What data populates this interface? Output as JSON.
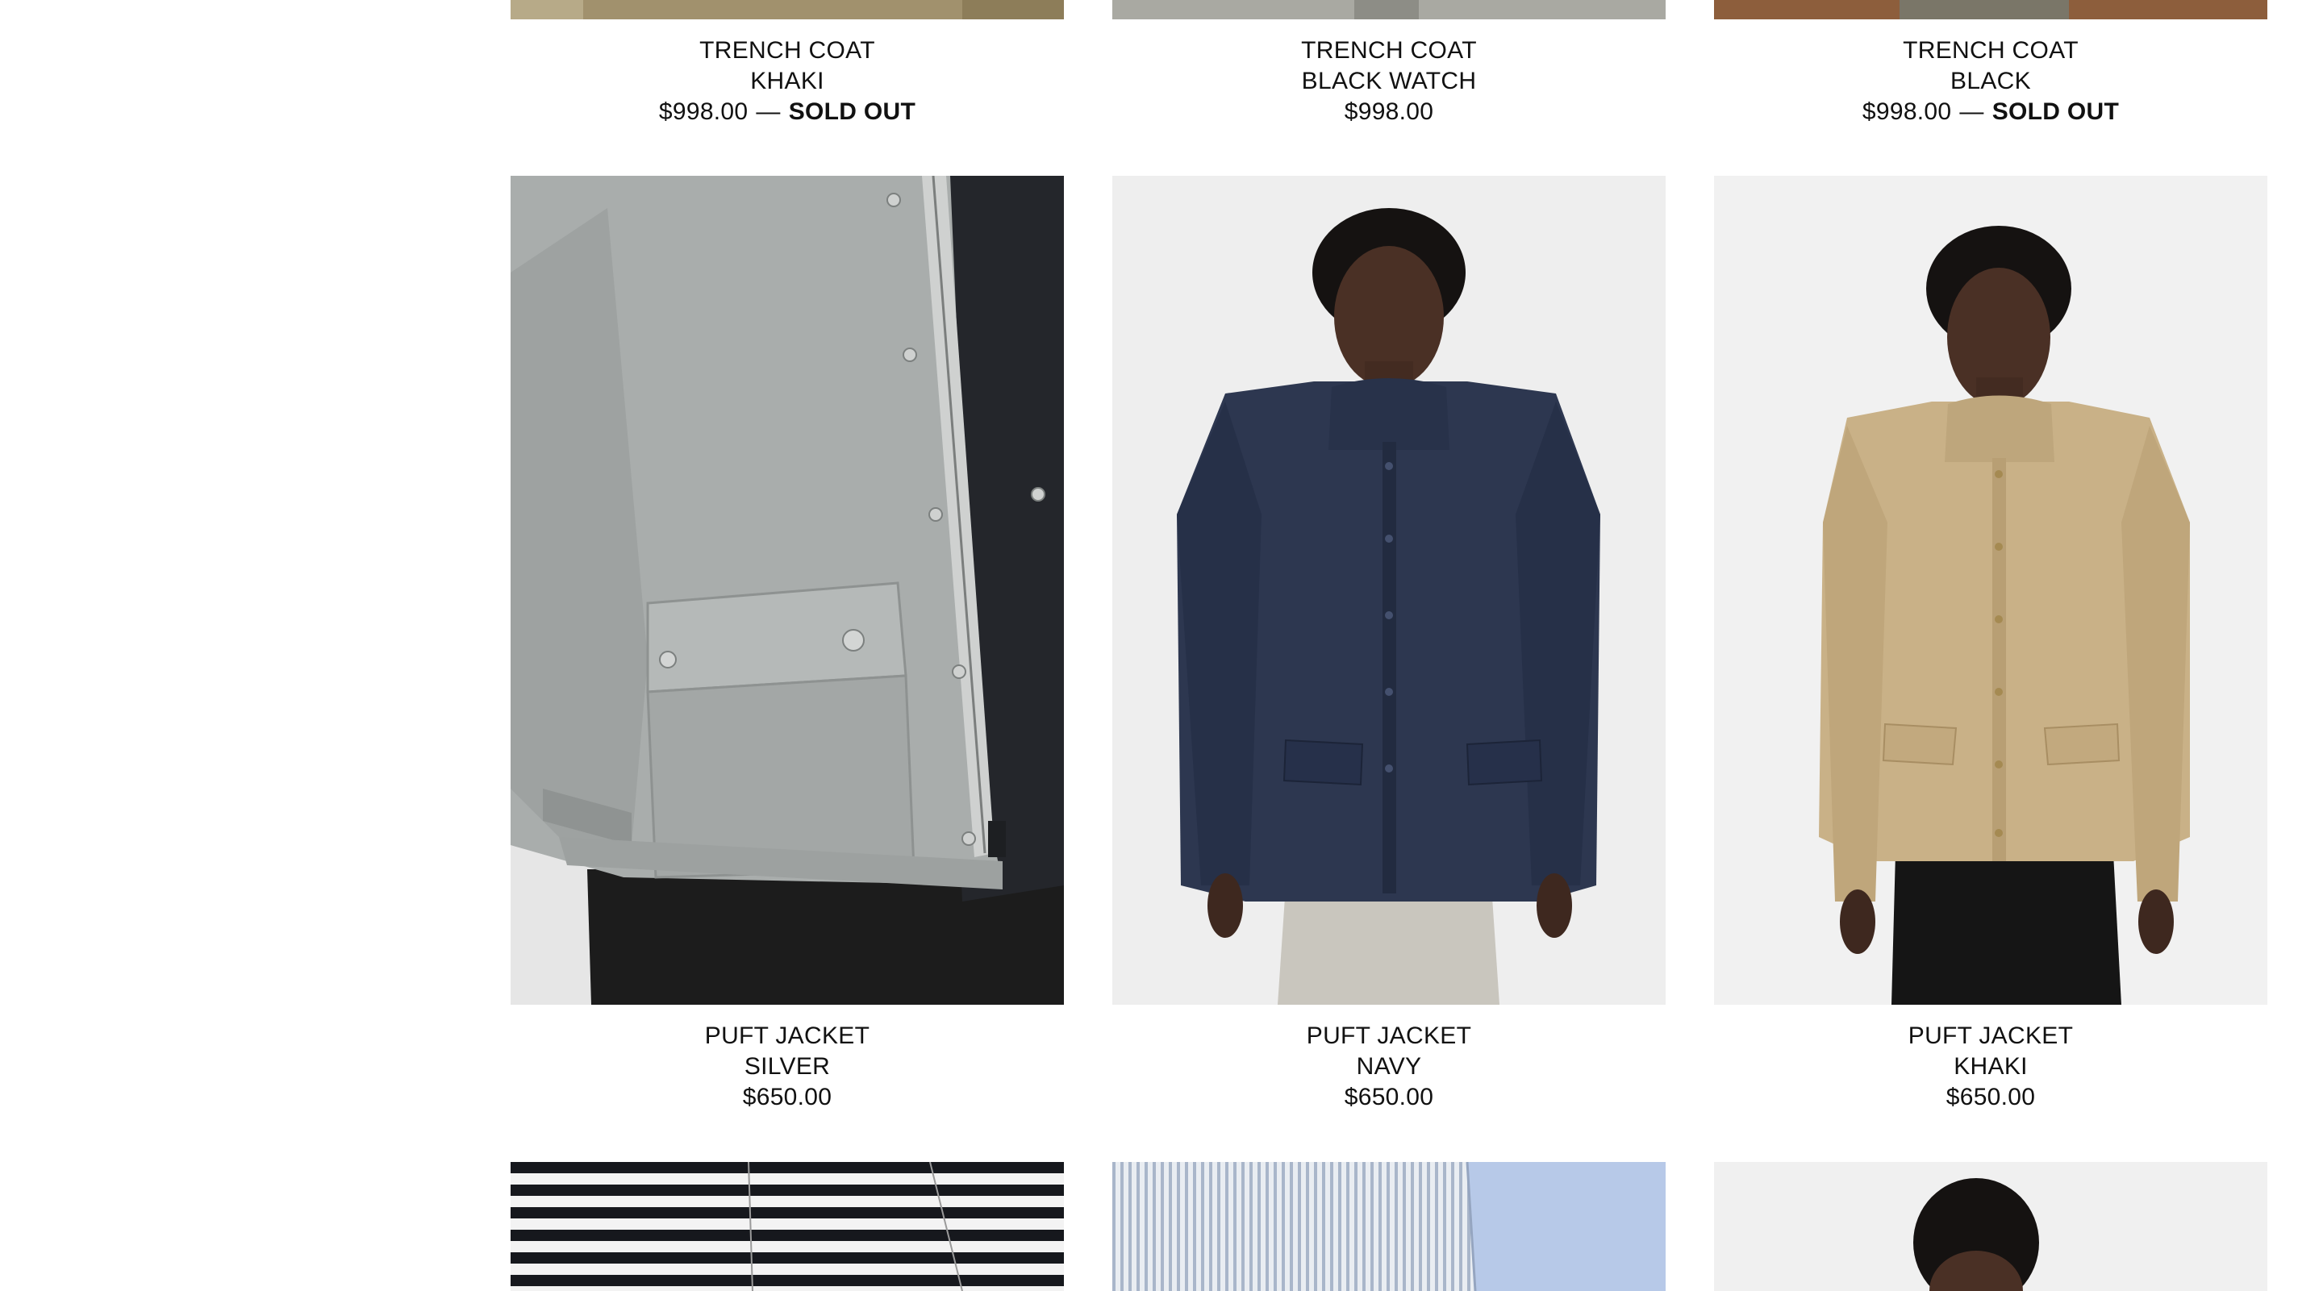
{
  "products": {
    "row1": [
      {
        "name": "TRENCH COAT",
        "color": "KHAKI",
        "price": "$998.00",
        "separator": "—",
        "status": "SOLD OUT",
        "swatch": "#a1916d"
      },
      {
        "name": "TRENCH COAT",
        "color": "BLACK WATCH",
        "price": "$998.00",
        "swatch": "#a9a9a2"
      },
      {
        "name": "TRENCH COAT",
        "color": "BLACK",
        "price": "$998.00",
        "separator": "—",
        "status": "SOLD OUT",
        "swatch": "#8d5e3c"
      }
    ],
    "row2": [
      {
        "name": "PUFT JACKET",
        "color": "SILVER",
        "price": "$650.00",
        "swatch": "#a9adac"
      },
      {
        "name": "PUFT JACKET",
        "color": "NAVY",
        "price": "$650.00",
        "swatch": "#2d3750"
      },
      {
        "name": "PUFT JACKET",
        "color": "KHAKI",
        "price": "$650.00",
        "swatch": "#c9b187"
      }
    ],
    "row3_images": [
      {
        "description": "striped-shirt"
      },
      {
        "description": "blue-stripe-shirt"
      },
      {
        "description": "model-partial"
      }
    ]
  }
}
